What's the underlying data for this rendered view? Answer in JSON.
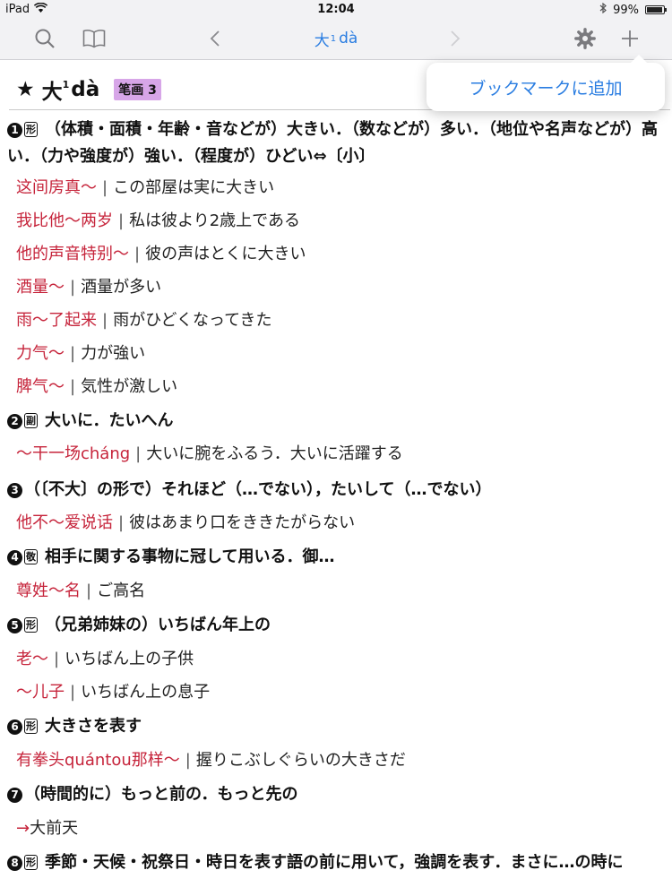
{
  "status": {
    "device": "iPad",
    "time": "12:04",
    "battery": "99%"
  },
  "toolbar": {
    "title_hanzi": "大",
    "title_sup": "1",
    "title_pinyin": "dà"
  },
  "popover": {
    "label": "ブックマークに追加"
  },
  "entry": {
    "star": "★",
    "headword": "大",
    "sup": "1",
    "pinyin": "dà",
    "stroke_badge": "笔画 3",
    "senses": [
      {
        "num": "1",
        "pos": "形",
        "text": "（体積・面積・年齢・音などが）大きい．（数などが）多い．（地位や名声などが）高い．（力や強度が）強い．（程度が）ひどい⇔〔小〕",
        "examples": [
          {
            "zh": "这间房真～",
            "jp": "この部屋は実に大きい"
          },
          {
            "zh": "我比他～两岁",
            "jp": "私は彼より2歳上である"
          },
          {
            "zh": "他的声音特别～",
            "jp": "彼の声はとくに大きい"
          },
          {
            "zh": "酒量～",
            "jp": "酒量が多い"
          },
          {
            "zh": "雨～了起来",
            "jp": "雨がひどくなってきた"
          },
          {
            "zh": "力气～",
            "jp": "力が強い"
          },
          {
            "zh": "脾气～",
            "jp": "気性が激しい"
          }
        ]
      },
      {
        "num": "2",
        "pos": "副",
        "text": "大いに．たいへん",
        "examples": [
          {
            "zh": "～干一场cháng",
            "jp": "大いに腕をふるう．大いに活躍する"
          }
        ]
      },
      {
        "num": "3",
        "pos": "",
        "text": "（〔不大〕の形で）それほど（…でない），たいして（…でない）",
        "examples": [
          {
            "zh": "他不～爱说话",
            "jp": "彼はあまり口をききたがらない"
          }
        ]
      },
      {
        "num": "4",
        "pos": "敬",
        "text": "相手に関する事物に冠して用いる．御…",
        "examples": [
          {
            "zh": "尊姓～名",
            "jp": "ご高名"
          }
        ]
      },
      {
        "num": "5",
        "pos": "形",
        "text": "（兄弟姉妹の）いちばん年上の",
        "examples": [
          {
            "zh": "老～",
            "jp": "いちばん上の子供"
          },
          {
            "zh": "～儿子",
            "jp": "いちばん上の息子"
          }
        ]
      },
      {
        "num": "6",
        "pos": "形",
        "text": "大きさを表す",
        "examples": [
          {
            "zh": "有拳头quántou那样～",
            "jp": "握りこぶしぐらいの大きさだ"
          }
        ]
      },
      {
        "num": "7",
        "pos": "",
        "text": "（時間的に）もっと前の．もっと先の",
        "examples": [
          {
            "zh": "→",
            "jp": "大前天"
          }
        ]
      },
      {
        "num": "8",
        "pos": "形",
        "text": "季節・天候・祝祭日・時日を表す語の前に用いて，強調を表す．まさに…の時に",
        "examples": []
      }
    ]
  },
  "colors": {
    "accent": "#2a7de1",
    "example_red": "#c6243b",
    "badge": "#d7a6e8"
  },
  "icons": [
    "wifi-icon",
    "bluetooth-icon",
    "battery-icon",
    "search-icon",
    "book-icon",
    "chevron-left-icon",
    "chevron-right-icon",
    "gear-icon",
    "plus-icon"
  ]
}
